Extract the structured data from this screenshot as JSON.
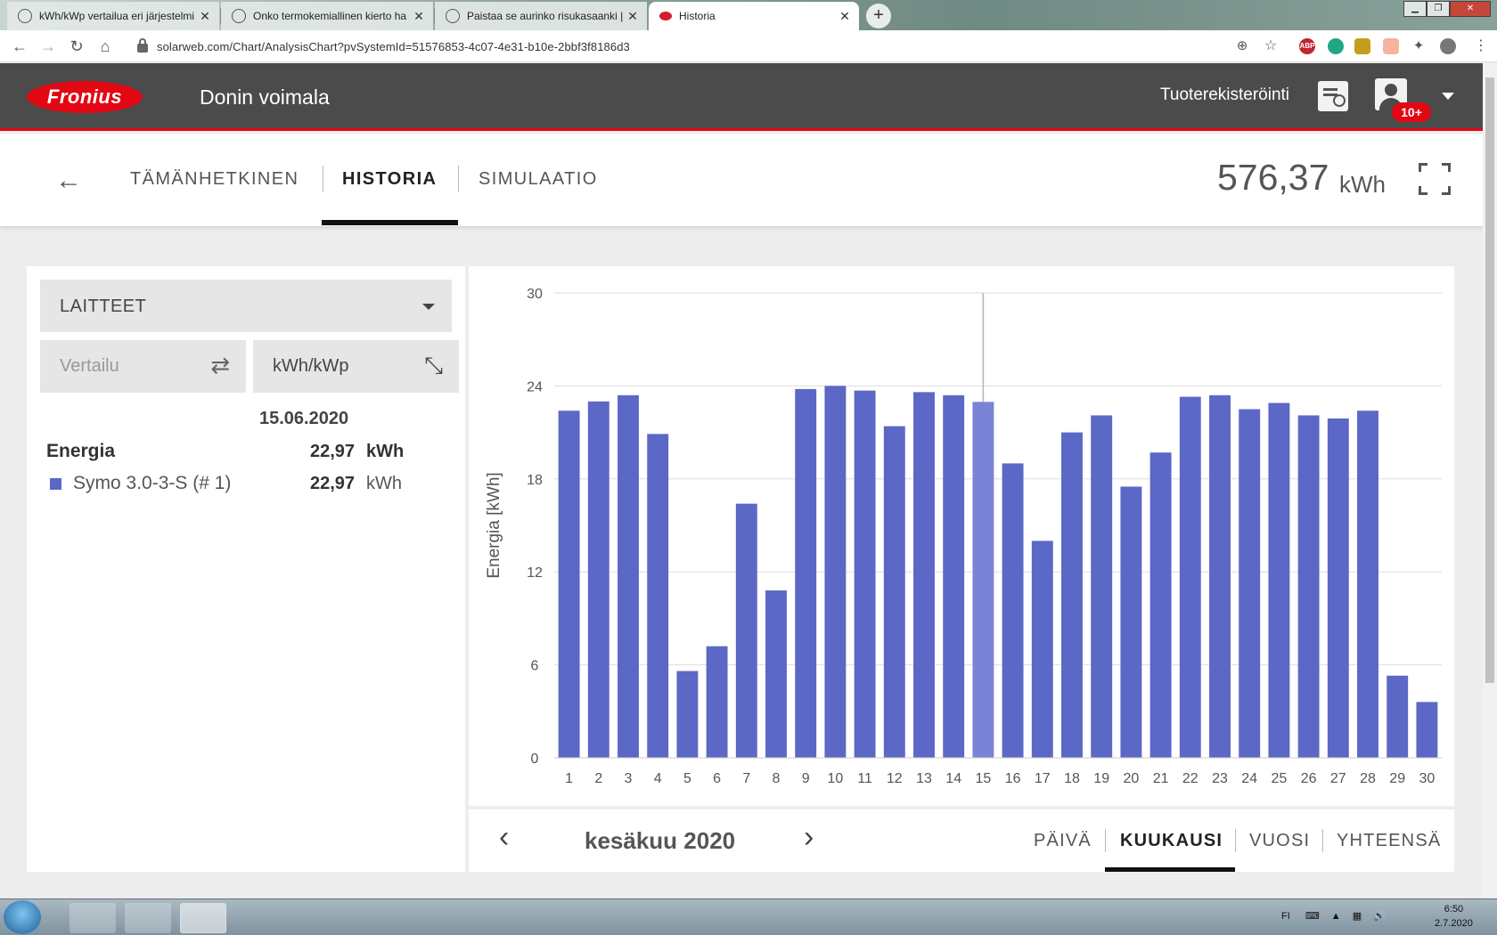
{
  "browser": {
    "tabs": [
      {
        "label": "kWh/kWp vertailua eri järjestelmi",
        "active": false
      },
      {
        "label": "Onko termokemiallinen kierto ha",
        "active": false
      },
      {
        "label": "Paistaa se aurinko risukasaanki | S",
        "active": false
      },
      {
        "label": "Historia",
        "active": true
      }
    ],
    "url": "solarweb.com/Chart/AnalysisChart?pvSystemId=51576853-4c07-4e31-b10e-2bbf3f8186d3",
    "extensions": [
      "ABP"
    ]
  },
  "header": {
    "logo_text": "Fronius",
    "system_name": "Donin voimala",
    "product_registration": "Tuoterekisteröinti",
    "notification_badge": "10+"
  },
  "subnav": {
    "tabs": [
      "TÄMÄNHETKINEN",
      "HISTORIA",
      "SIMULAATIO"
    ],
    "active_tab": "HISTORIA",
    "total_value": "576,37",
    "total_unit": "kWh"
  },
  "left_panel": {
    "device_select": "LAITTEET",
    "compare_label": "Vertailu",
    "unit_toggle": "kWh/kWp",
    "selected_date": "15.06.2020",
    "energy_label": "Energia",
    "energy_value": "22,97",
    "energy_unit": "kWh",
    "device_name": "Symo 3.0-3-S (# 1)",
    "device_value": "22,97",
    "device_unit": "kWh"
  },
  "chart_data": {
    "type": "bar",
    "ylabel": "Energia [kWh]",
    "ylim": [
      0,
      30
    ],
    "yticks": [
      0,
      6,
      12,
      18,
      24,
      30
    ],
    "grid": true,
    "highlighted_category": "15",
    "categories": [
      "1",
      "2",
      "3",
      "4",
      "5",
      "6",
      "7",
      "8",
      "9",
      "10",
      "11",
      "12",
      "13",
      "14",
      "15",
      "16",
      "17",
      "18",
      "19",
      "20",
      "21",
      "22",
      "23",
      "24",
      "25",
      "26",
      "27",
      "28",
      "29",
      "30"
    ],
    "series": [
      {
        "values": [
          22.4,
          23.0,
          23.4,
          20.9,
          5.6,
          7.2,
          16.4,
          10.8,
          23.8,
          24.0,
          23.7,
          21.4,
          23.6,
          23.4,
          22.97,
          19.0,
          14.0,
          21.0,
          22.1,
          17.5,
          19.7,
          23.3,
          23.4,
          22.5,
          22.9,
          22.1,
          21.9,
          22.4,
          5.3,
          3.6
        ],
        "color": "#5b68c6",
        "highlight_color": "#7a83d6"
      }
    ]
  },
  "bottom_bar": {
    "period": "kesäkuu 2020",
    "ranges": [
      "PÄIVÄ",
      "KUUKAUSI",
      "VUOSI",
      "YHTEENSÄ"
    ],
    "active_range": "KUUKAUSI"
  },
  "taskbar": {
    "language": "FI",
    "time": "6:50",
    "date": "2.7.2020"
  }
}
